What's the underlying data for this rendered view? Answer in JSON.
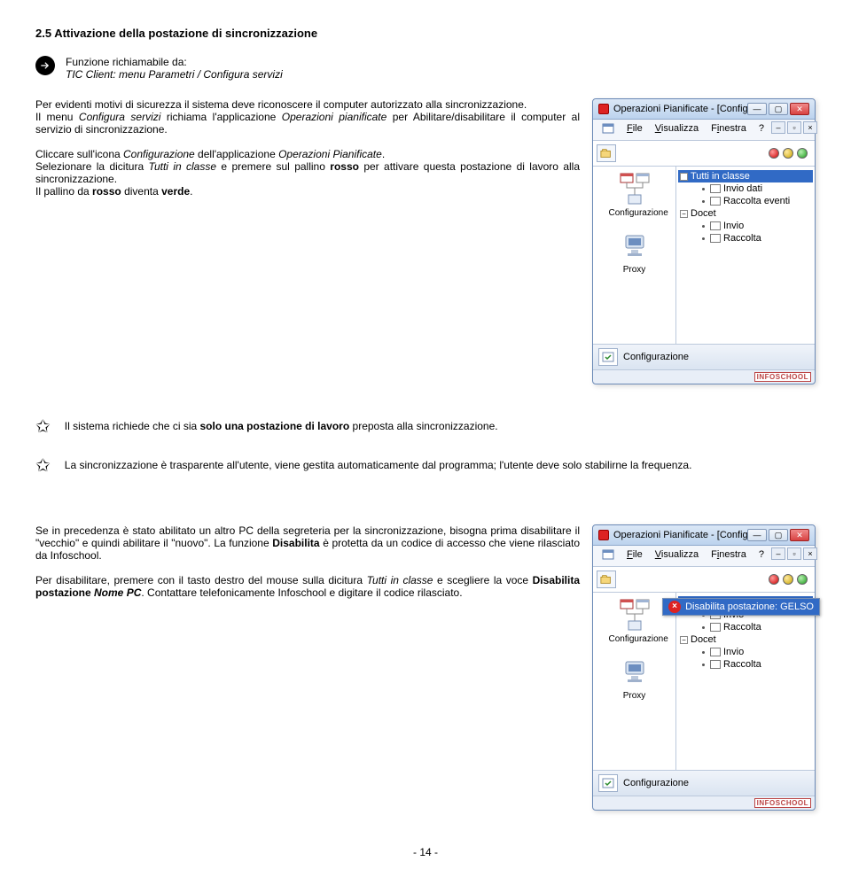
{
  "heading": "2.5    Attivazione della postazione di sincronizzazione",
  "funcFrom": {
    "title": "Funzione richiamabile da:",
    "line": "TIC Client: menu Parametri / Configura servizi"
  },
  "para1_a": "Per evidenti motivi di sicurezza il sistema deve riconoscere il computer autorizzato alla sincronizzazione.",
  "para1_b_pre": "Il menu ",
  "para1_b_ital": "Configura servizi",
  "para1_b_mid": " richiama l'applicazione ",
  "para1_b_ital2": "Operazioni pianificate",
  "para1_b_end": " per Abilitare/disabilitare il computer al servizio di sincronizzazione.",
  "para2_a": "Cliccare sull'icona ",
  "para2_b": "Configurazione",
  "para2_c": " dell'applicazione ",
  "para2_d": "Operazioni Pianificate",
  "para2_e": ".",
  "para3_a": "Selezionare la dicitura ",
  "para3_b": "Tutti in classe",
  "para3_c": " e premere sul pallino ",
  "para3_d": "rosso",
  "para3_e": " per attivare questa postazione di lavoro alla sincronizzazione.",
  "para4_a": "Il pallino da ",
  "para4_b": "rosso",
  "para4_c": " diventa ",
  "para4_d": "verde",
  "para4_e": ".",
  "note1_a": "Il sistema richiede che ci sia ",
  "note1_b": "solo una postazione di lavoro",
  "note1_c": " preposta alla sincronizzazione.",
  "note2": "La sincronizzazione è trasparente all'utente, viene gestita automaticamente dal programma; l'utente deve solo stabilirne la frequenza.",
  "para5_a": "Se in precedenza è stato abilitato un altro PC della segreteria per la sincronizzazione, bisogna prima disabilitare il \"vecchio\" e quindi abilitare il \"nuovo\". La funzione ",
  "para5_b": "Disabilita",
  "para5_c": " è protetta da un codice di accesso che viene rilasciato da Infoschool.",
  "para6_a": "Per disabilitare, premere con il tasto destro del mouse sulla dicitura ",
  "para6_b": "Tutti in classe",
  "para6_c": " e scegliere la voce ",
  "para6_d": "Disabilita postazione ",
  "para6_e": "Nome PC",
  "para6_f": ". Contattare telefonicamente Infoschool e digitare il codice rilasciato.",
  "pagenum": "- 14 -",
  "win": {
    "title": "Operazioni Pianificate - [Configurazio…",
    "menus": {
      "file": "File",
      "file_u": "F",
      "vis": "Visualizza",
      "vis_u": "V",
      "fin": "Finestra",
      "fin_u": "F",
      "help": "?"
    },
    "side": {
      "cfg": "Configurazione",
      "proxy": "Proxy"
    },
    "tree": {
      "root1": "Tutti in classe",
      "c1": "Invio dati",
      "c2": "Raccolta eventi",
      "root2": "Docet",
      "c3": "Invio",
      "c4": "Raccolta"
    },
    "bottom": "Configurazione",
    "brand": "INFOSCHOOL",
    "ctx": "Disabilita postazione: GELSO"
  }
}
